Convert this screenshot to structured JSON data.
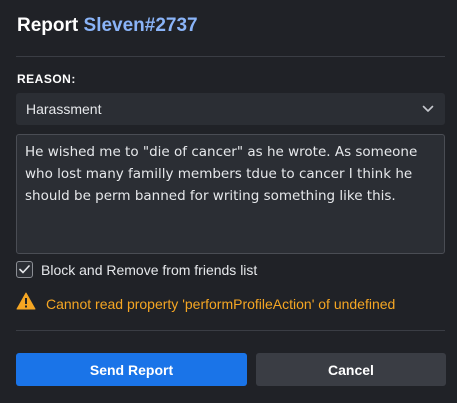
{
  "dialog": {
    "title_prefix": "Report",
    "title_username": "Sleven#2737",
    "accent_color": "#8ab4f8"
  },
  "reason": {
    "label": "REASON:",
    "selected": "Harassment",
    "icon": "chevron-down-icon"
  },
  "description": {
    "value": "He wished me to \"die of cancer\" as he wrote. As someone who lost many familly members tdue to cancer I think he should be perm banned for writing something like this."
  },
  "block_option": {
    "label": "Block and Remove from friends list",
    "checked": true,
    "icon": "checkmark-icon"
  },
  "error": {
    "message": "Cannot read property 'performProfileAction' of undefined",
    "icon": "warning-icon",
    "color": "#f5a623"
  },
  "buttons": {
    "send_label": "Send Report",
    "send_color": "#1a74e8",
    "cancel_label": "Cancel"
  }
}
